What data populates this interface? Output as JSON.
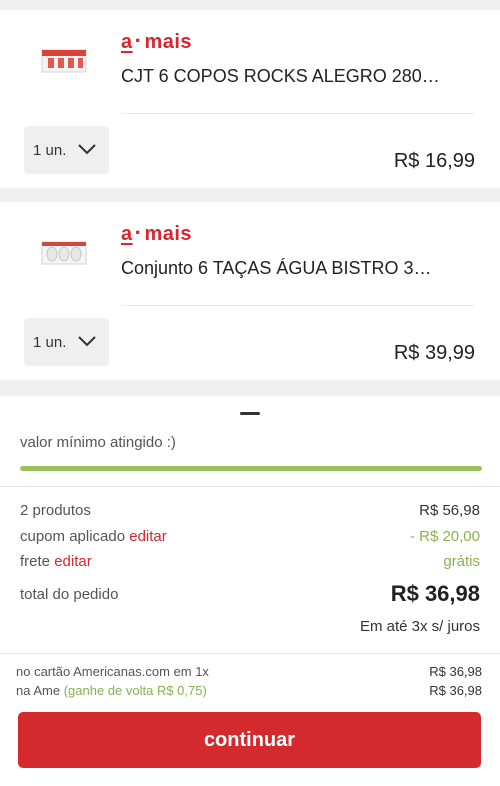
{
  "cart": {
    "items": [
      {
        "brand": {
          "a": "a",
          "dot": "·",
          "rest": "mais"
        },
        "title": "CJT 6 COPOS ROCKS ALEGRO 280…",
        "quantity": "1 un.",
        "price": "R$ 16,99"
      },
      {
        "brand": {
          "a": "a",
          "dot": "·",
          "rest": "mais"
        },
        "title": "Conjunto 6 TAÇAS ÁGUA BISTRO 3…",
        "quantity": "1 un.",
        "price": "R$ 39,99"
      }
    ]
  },
  "summary": {
    "min_value_text": "valor mínimo atingido :)",
    "progress_percent": 100,
    "products_label": "2 produtos",
    "products_value": "R$ 56,98",
    "coupon_label": "cupom aplicado",
    "coupon_edit": "editar",
    "coupon_value": "- R$ 20,00",
    "shipping_label": "frete",
    "shipping_edit": "editar",
    "shipping_value": "grátis",
    "total_label": "total do pedido",
    "total_value": "R$ 36,98",
    "installments": "Em até 3x s/ juros",
    "card_label": "no cartão Americanas.com em 1x",
    "card_value": "R$ 36,98",
    "ame_label": "na Ame",
    "ame_cashback": "(ganhe de volta R$ 0,75)",
    "ame_value": "R$ 36,98",
    "continue_label": "continuar"
  },
  "colors": {
    "brand_red": "#d7262f",
    "progress_green": "#9bbf5a",
    "cta_red": "#d42a2e"
  },
  "icons": {
    "dropdown": "chevron-down-icon"
  }
}
